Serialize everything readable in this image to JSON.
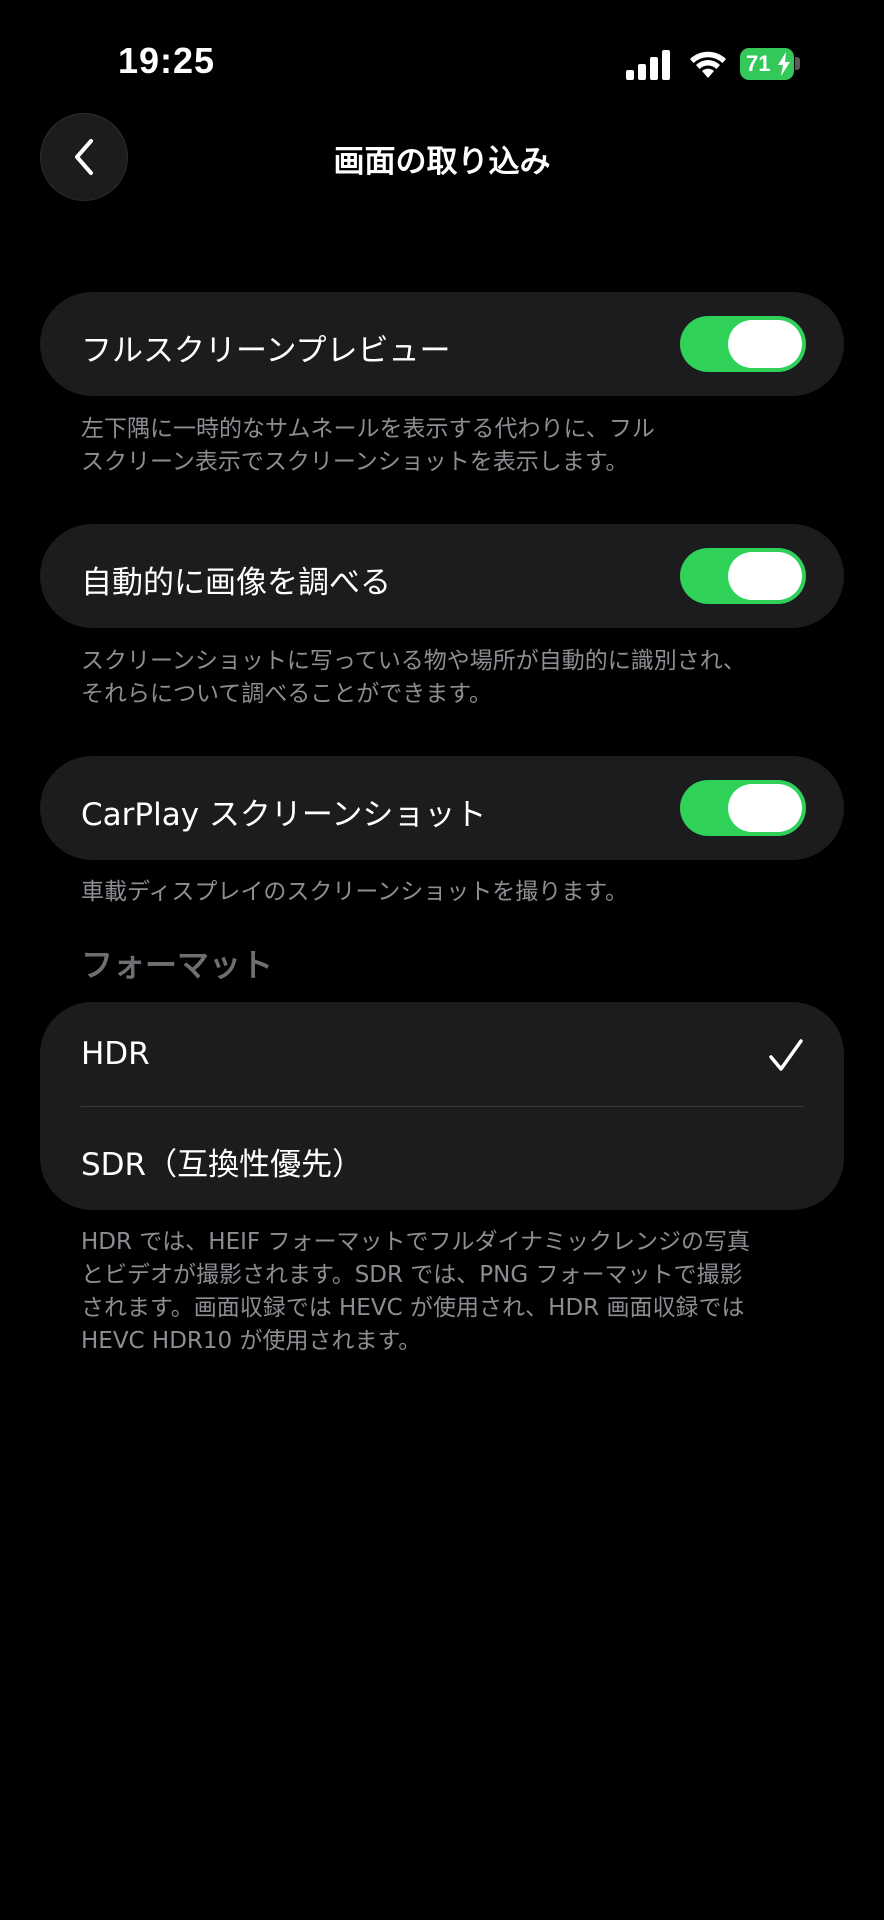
{
  "status_bar": {
    "time": "19:25",
    "battery": "71",
    "battery_color": "#34c759"
  },
  "nav": {
    "title": "画面の取り込み",
    "back_icon": "chevron-left-icon"
  },
  "settings": [
    {
      "label": "フルスクリーンプレビュー",
      "on": true,
      "footnote": [
        "左下隅に一時的なサムネールを表示する代わりに、フル",
        "スクリーン表示でスクリーンショットを表示します。"
      ]
    },
    {
      "label": "自動的に画像を調べる",
      "on": true,
      "footnote": [
        "スクリーンショットに写っている物や場所が自動的に識別され、",
        "それらについて調べることができます。"
      ]
    },
    {
      "label": "CarPlay スクリーンショット",
      "on": true,
      "footnote": [
        "車載ディスプレイのスクリーンショットを撮ります。"
      ]
    }
  ],
  "format": {
    "header": "フォーマット",
    "options": [
      {
        "label": "HDR",
        "selected": true
      },
      {
        "label": "SDR（互換性優先）",
        "selected": false
      }
    ],
    "footnote": [
      "HDR では、HEIF フォーマットでフルダイナミックレンジの写真",
      "とビデオが撮影されます。SDR では、PNG フォーマットで撮影",
      "されます。画面収録では HEVC が使用され、HDR 画面収録では",
      "HEVC HDR10 が使用されます。"
    ]
  },
  "colors": {
    "toggle_on": "#30d158",
    "card_bg": "#1c1c1e",
    "footnote": "#8d8d93"
  }
}
